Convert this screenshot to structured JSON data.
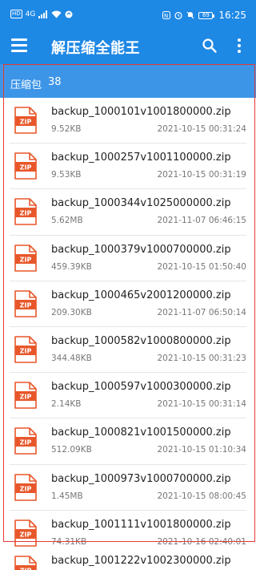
{
  "status_bar": {
    "hd": "HD",
    "signal": "4G",
    "battery": "69",
    "time": "16:25"
  },
  "app_bar": {
    "title": "解压缩全能王",
    "menu_icon": "menu-icon",
    "search_icon": "search-icon",
    "more_icon": "more-vertical-icon"
  },
  "section": {
    "label": "压缩包",
    "count": "38"
  },
  "files": [
    {
      "name": "backup_1000101v1001800000.zip",
      "size": "9.52KB",
      "date": "2021-10-15 00:31:24"
    },
    {
      "name": "backup_1000257v1001100000.zip",
      "size": "9.53KB",
      "date": "2021-10-15 00:31:19"
    },
    {
      "name": "backup_1000344v1025000000.zip",
      "size": "5.62MB",
      "date": "2021-11-07 06:46:15"
    },
    {
      "name": "backup_1000379v1000700000.zip",
      "size": "459.39KB",
      "date": "2021-10-15 01:50:40"
    },
    {
      "name": "backup_1000465v2001200000.zip",
      "size": "209.30KB",
      "date": "2021-11-07 06:50:14"
    },
    {
      "name": "backup_1000582v1000800000.zip",
      "size": "344.48KB",
      "date": "2021-10-15 00:31:23"
    },
    {
      "name": "backup_1000597v1000300000.zip",
      "size": "2.14KB",
      "date": "2021-10-15 00:31:14"
    },
    {
      "name": "backup_1000821v1001500000.zip",
      "size": "512.09KB",
      "date": "2021-10-15 01:10:34"
    },
    {
      "name": "backup_1000973v1000700000.zip",
      "size": "1.45MB",
      "date": "2021-10-15 08:00:45"
    },
    {
      "name": "backup_1001111v1001800000.zip",
      "size": "74.31KB",
      "date": "2021-10-16 02:40:01"
    },
    {
      "name": "backup_1001222v1002300000.zip",
      "size": "",
      "date": ""
    }
  ],
  "icon_label": "ZIP",
  "colors": {
    "primary": "#1E88E5",
    "section": "#3D95E8",
    "zip_icon": "#E8572A",
    "highlight": "#E53935"
  }
}
